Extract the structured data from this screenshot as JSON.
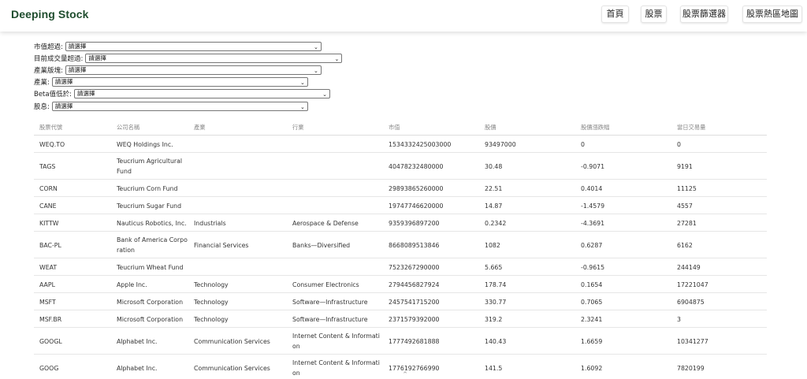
{
  "header": {
    "brand": "Deeping Stock",
    "nav": [
      {
        "label": "首頁"
      },
      {
        "label": "股票"
      },
      {
        "label": "股票篩選器"
      },
      {
        "label": "股票熱區地圖"
      }
    ]
  },
  "filters": [
    {
      "label": "市值超過:",
      "value": "請選擇"
    },
    {
      "label": "目前成交量超過:",
      "value": "請選擇"
    },
    {
      "label": "產業版塊:",
      "value": "請選擇"
    },
    {
      "label": "產業:",
      "value": "請選擇"
    },
    {
      "label": "Beta值低於:",
      "value": "請選擇"
    },
    {
      "label": "股息:",
      "value": "請選擇"
    }
  ],
  "table": {
    "columns": [
      "股票代號",
      "公司名稱",
      "產業",
      "行業",
      "市值",
      "股價",
      "股價漲跌幅",
      "當日交易量"
    ],
    "rows": [
      [
        "WEQ.TO",
        "WEQ Holdings Inc.",
        "",
        "",
        "1534332425003000",
        "93497000",
        "0",
        "0"
      ],
      [
        "TAGS",
        "Teucrium Agricultural Fund",
        "",
        "",
        "40478232480000",
        "30.48",
        "-0.9071",
        "9191"
      ],
      [
        "CORN",
        "Teucrium Corn Fund",
        "",
        "",
        "29893865260000",
        "22.51",
        "0.4014",
        "11125"
      ],
      [
        "CANE",
        "Teucrium Sugar Fund",
        "",
        "",
        "19747746620000",
        "14.87",
        "-1.4579",
        "4557"
      ],
      [
        "KITTW",
        "Nauticus Robotics, Inc.",
        "Industrials",
        "Aerospace & Defense",
        "9359396897200",
        "0.2342",
        "-4.3691",
        "27281"
      ],
      [
        "BAC-PL",
        "Bank of America Corporation",
        "Financial Services",
        "Banks—Diversified",
        "8668089513846",
        "1082",
        "0.6287",
        "6162"
      ],
      [
        "WEAT",
        "Teucrium Wheat Fund",
        "",
        "",
        "7523267290000",
        "5.665",
        "-0.9615",
        "244149"
      ],
      [
        "AAPL",
        "Apple Inc.",
        "Technology",
        "Consumer Electronics",
        "2794456827924",
        "178.74",
        "0.1654",
        "17221047"
      ],
      [
        "MSFT",
        "Microsoft Corporation",
        "Technology",
        "Software—Infrastructure",
        "2457541715200",
        "330.77",
        "0.7065",
        "6904875"
      ],
      [
        "MSF.BR",
        "Microsoft Corporation",
        "Technology",
        "Software—Infrastructure",
        "2371579392000",
        "319.2",
        "2.3241",
        "3"
      ],
      [
        "GOOGL",
        "Alphabet Inc.",
        "Communication Services",
        "Internet Content & Information",
        "1777492681888",
        "140.43",
        "1.6659",
        "10341277"
      ],
      [
        "GOOG",
        "Alphabet Inc.",
        "Communication Services",
        "Internet Content & Information",
        "1776192766990",
        "141.5",
        "1.6092",
        "7820199"
      ]
    ]
  }
}
